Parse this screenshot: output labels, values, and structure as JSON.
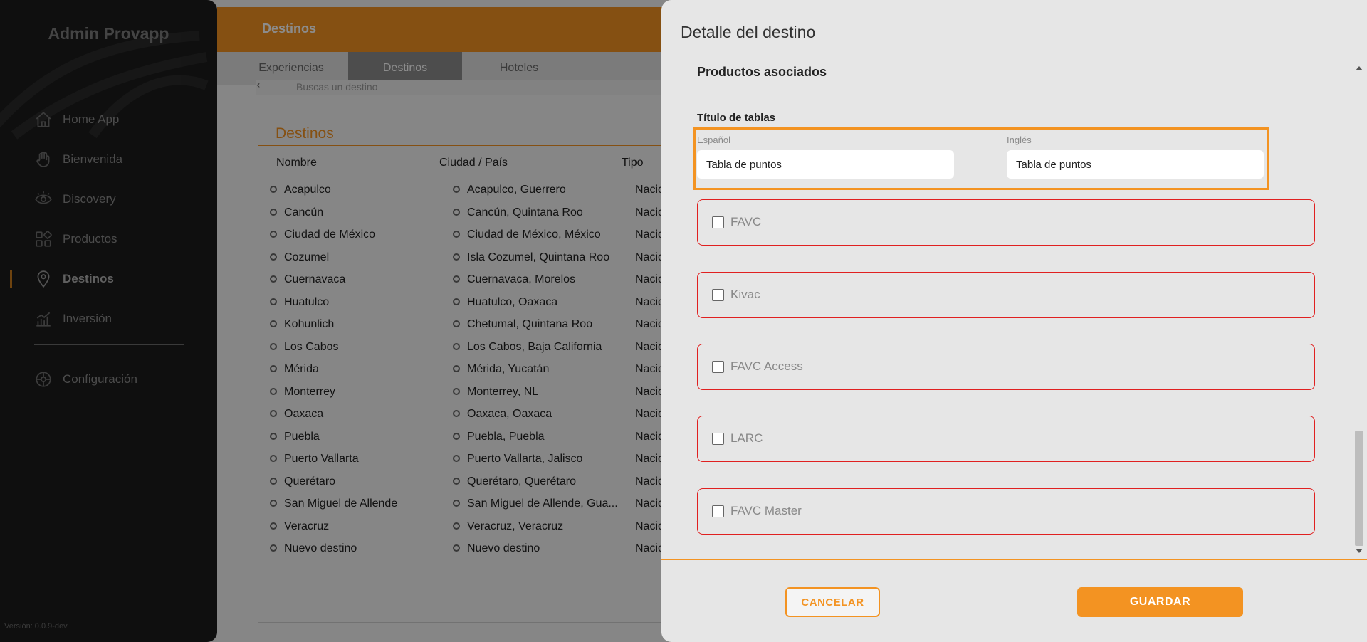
{
  "sidebar": {
    "brand": "Admin Provapp",
    "items": [
      {
        "label": "Home App",
        "icon": "home-icon"
      },
      {
        "label": "Bienvenida",
        "icon": "wave-hand-icon"
      },
      {
        "label": "Discovery",
        "icon": "eye-icon"
      },
      {
        "label": "Productos",
        "icon": "grid-icon"
      },
      {
        "label": "Destinos",
        "icon": "location-pin-icon",
        "active": true
      },
      {
        "label": "Inversión",
        "icon": "chart-icon"
      }
    ],
    "config": {
      "label": "Configuración",
      "icon": "gear-icon"
    },
    "version": "Versión: 0.0.9-dev"
  },
  "main": {
    "header_title": "Destinos",
    "tabs": [
      {
        "label": "Experiencias"
      },
      {
        "label": "Destinos",
        "active": true
      },
      {
        "label": "Hoteles"
      }
    ],
    "search_placeholder": "Buscas un destino",
    "section_title": "Destinos",
    "columns": [
      "Nombre",
      "Ciudad / País",
      "Tipo"
    ],
    "rows": [
      {
        "name": "Acapulco",
        "city": "Acapulco, Guerrero",
        "type": "Nacio"
      },
      {
        "name": "Cancún",
        "city": "Cancún, Quintana Roo",
        "type": "Nacio"
      },
      {
        "name": "Ciudad de México",
        "city": "Ciudad de México, México",
        "type": "Nacio"
      },
      {
        "name": "Cozumel",
        "city": "Isla Cozumel, Quintana Roo",
        "type": "Nacio"
      },
      {
        "name": "Cuernavaca",
        "city": "Cuernavaca, Morelos",
        "type": "Nacio"
      },
      {
        "name": "Huatulco",
        "city": "Huatulco, Oaxaca",
        "type": "Nacio"
      },
      {
        "name": "Kohunlich",
        "city": "Chetumal, Quintana Roo",
        "type": "Nacio"
      },
      {
        "name": "Los Cabos",
        "city": "Los Cabos, Baja California",
        "type": "Nacio"
      },
      {
        "name": "Mérida",
        "city": "Mérida, Yucatán",
        "type": "Nacio"
      },
      {
        "name": "Monterrey",
        "city": "Monterrey, NL",
        "type": "Nacio"
      },
      {
        "name": "Oaxaca",
        "city": "Oaxaca, Oaxaca",
        "type": "Nacio"
      },
      {
        "name": "Puebla",
        "city": "Puebla, Puebla",
        "type": "Nacio"
      },
      {
        "name": "Puerto Vallarta",
        "city": "Puerto Vallarta, Jalisco",
        "type": "Nacio"
      },
      {
        "name": "Querétaro",
        "city": "Querétaro, Querétaro",
        "type": "Nacio"
      },
      {
        "name": "San Miguel de Allende",
        "city": "San Miguel de Allende, Gua...",
        "type": "Nacio"
      },
      {
        "name": "Veracruz",
        "city": "Veracruz, Veracruz",
        "type": "Nacio"
      },
      {
        "name": "Nuevo destino",
        "city": "Nuevo destino",
        "type": "Nacio"
      }
    ]
  },
  "panel": {
    "title": "Detalle del destino",
    "subtitle": "Productos asociados",
    "tables_label": "Título de tablas",
    "spanish": {
      "label": "Español",
      "value": "Tabla de puntos"
    },
    "english": {
      "label": "Inglés",
      "value": "Tabla de puntos"
    },
    "products": [
      {
        "name": "FAVC",
        "checked": false
      },
      {
        "name": "Kivac",
        "checked": false
      },
      {
        "name": "FAVC Access",
        "checked": false
      },
      {
        "name": "LARC",
        "checked": false
      },
      {
        "name": "FAVC Master",
        "checked": false
      }
    ],
    "cancel_label": "CANCELAR",
    "save_label": "GUARDAR"
  },
  "colors": {
    "accent": "#f39322",
    "sidebar_bg": "#1c1c1c",
    "error_border": "#e02020",
    "panel_bg": "#e6e6e6"
  }
}
